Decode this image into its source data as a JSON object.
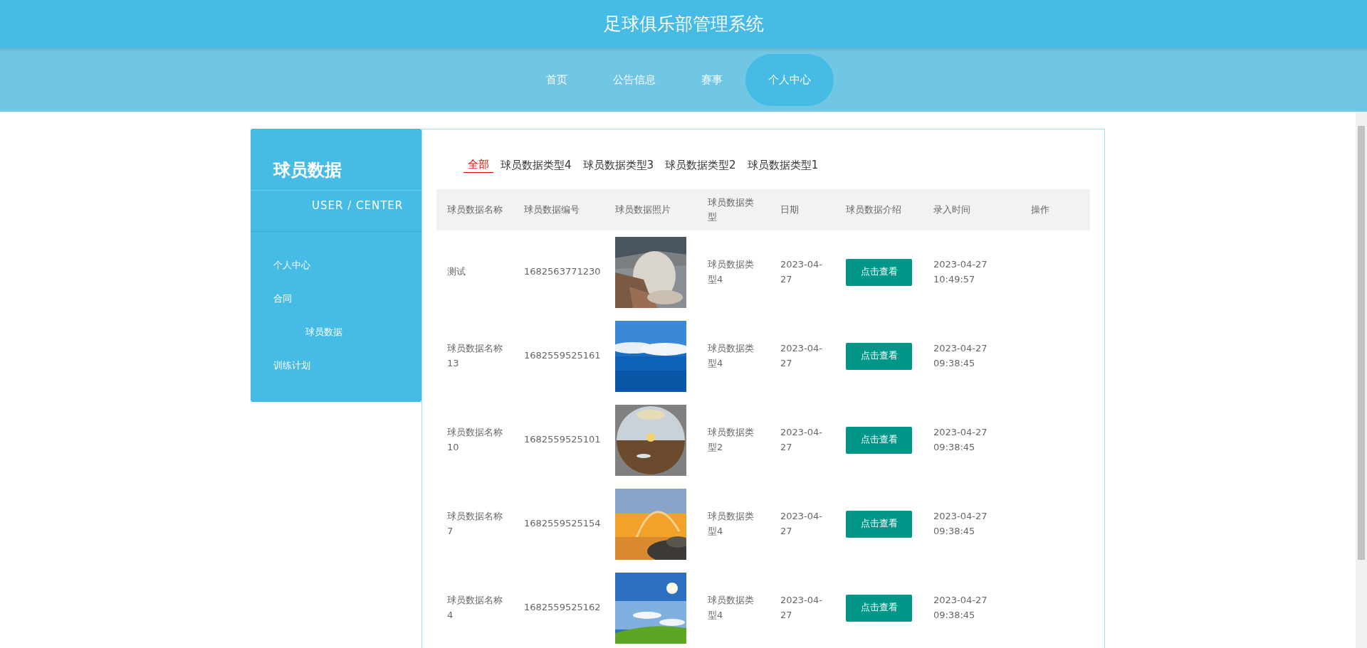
{
  "site_title": "足球俱乐部管理系统",
  "nav": [
    {
      "label": "首页",
      "selected": false
    },
    {
      "label": "公告信息",
      "selected": false
    },
    {
      "label": "赛事",
      "selected": false
    },
    {
      "label": "个人中心",
      "selected": true
    }
  ],
  "sidebar": {
    "title": "球员数据",
    "subtitle": "USER / CENTER",
    "items": [
      {
        "label": "个人中心"
      },
      {
        "label": "合同",
        "children": [
          {
            "label": "球员数据"
          }
        ]
      },
      {
        "label": "训练计划"
      }
    ]
  },
  "filters": [
    {
      "label": "全部",
      "selected": true
    },
    {
      "label": "球员数据类型4",
      "selected": false
    },
    {
      "label": "球员数据类型3",
      "selected": false
    },
    {
      "label": "球员数据类型2",
      "selected": false
    },
    {
      "label": "球员数据类型1",
      "selected": false
    }
  ],
  "table": {
    "columns": [
      "球员数据名称",
      "球员数据编号",
      "球员数据照片",
      "球员数据类型",
      "日期",
      "球员数据介绍",
      "录入时间",
      "操作"
    ],
    "rows": [
      {
        "name": "测试",
        "number": "1682563771230",
        "type": "球员数据类型4",
        "date": "2023-04-27",
        "button": "点击查看",
        "created": "2023-04-27 10:49:57"
      },
      {
        "name": "球员数据名称13",
        "number": "1682559525161",
        "type": "球员数据类型4",
        "date": "2023-04-27",
        "button": "点击查看",
        "created": "2023-04-27 09:38:45"
      },
      {
        "name": "球员数据名称10",
        "number": "1682559525101",
        "type": "球员数据类型2",
        "date": "2023-04-27",
        "button": "点击查看",
        "created": "2023-04-27 09:38:45"
      },
      {
        "name": "球员数据名称7",
        "number": "1682559525154",
        "type": "球员数据类型4",
        "date": "2023-04-27",
        "button": "点击查看",
        "created": "2023-04-27 09:38:45"
      },
      {
        "name": "球员数据名称4",
        "number": "1682559525162",
        "type": "球员数据类型4",
        "date": "2023-04-27",
        "button": "点击查看",
        "created": "2023-04-27 09:38:45"
      }
    ]
  }
}
